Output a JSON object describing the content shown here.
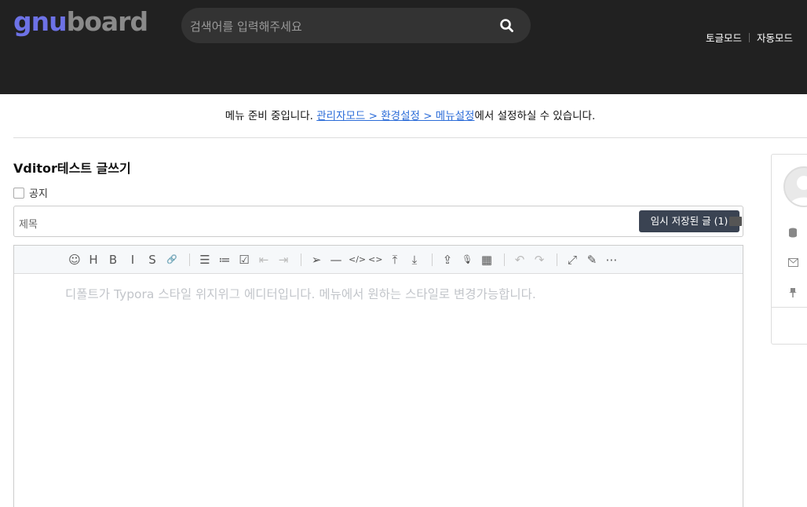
{
  "header": {
    "logo_part1": "gnu",
    "logo_part2": "board",
    "search_placeholder": "검색어를 입력해주세요",
    "nav": [
      "토글모드",
      "자동모드"
    ]
  },
  "notice": {
    "prefix": "메뉴 준비 중입니다. ",
    "link": "관리자모드 > 환경설정 > 메뉴설정",
    "suffix": "에서 설정하실 수 있습니다."
  },
  "form": {
    "title": "Vditor테스트 글쓰기",
    "notice_label": "공지",
    "subject_placeholder": "제목",
    "autosave_label": "임시 저장된 글 (1)"
  },
  "editor": {
    "placeholder": "디폴트가 Typora 스타일 위지위그 에디터입니다. 메뉴에서 원하는 스타일로 변경가능합니다.",
    "toolbar": [
      {
        "name": "emoji-icon",
        "glyph": "☺"
      },
      {
        "name": "headings-icon",
        "glyph": "H"
      },
      {
        "name": "bold-icon",
        "glyph": "B"
      },
      {
        "name": "italic-icon",
        "glyph": "I"
      },
      {
        "name": "strike-icon",
        "glyph": "S"
      },
      {
        "name": "link-icon",
        "glyph": "🔗"
      },
      {
        "name": "list-icon",
        "glyph": "☰"
      },
      {
        "name": "ordered-list-icon",
        "glyph": "≔"
      },
      {
        "name": "check-icon",
        "glyph": "☑"
      },
      {
        "name": "outdent-icon",
        "glyph": "⇤"
      },
      {
        "name": "indent-icon",
        "glyph": "⇥"
      },
      {
        "name": "quote-icon",
        "glyph": "➢"
      },
      {
        "name": "line-icon",
        "glyph": "—"
      },
      {
        "name": "code-icon",
        "glyph": "</>"
      },
      {
        "name": "inline-code-icon",
        "glyph": "<>"
      },
      {
        "name": "insert-before-icon",
        "glyph": "⤒"
      },
      {
        "name": "insert-after-icon",
        "glyph": "⤓"
      },
      {
        "name": "upload-icon",
        "glyph": "⇪"
      },
      {
        "name": "record-icon",
        "glyph": "🎙"
      },
      {
        "name": "table-icon",
        "glyph": "▦"
      },
      {
        "name": "undo-icon",
        "glyph": "↶"
      },
      {
        "name": "redo-icon",
        "glyph": "↷"
      },
      {
        "name": "fullscreen-icon",
        "glyph": "⤢"
      },
      {
        "name": "edit-mode-icon",
        "glyph": "✎"
      },
      {
        "name": "more-icon",
        "glyph": "⋯"
      }
    ]
  }
}
